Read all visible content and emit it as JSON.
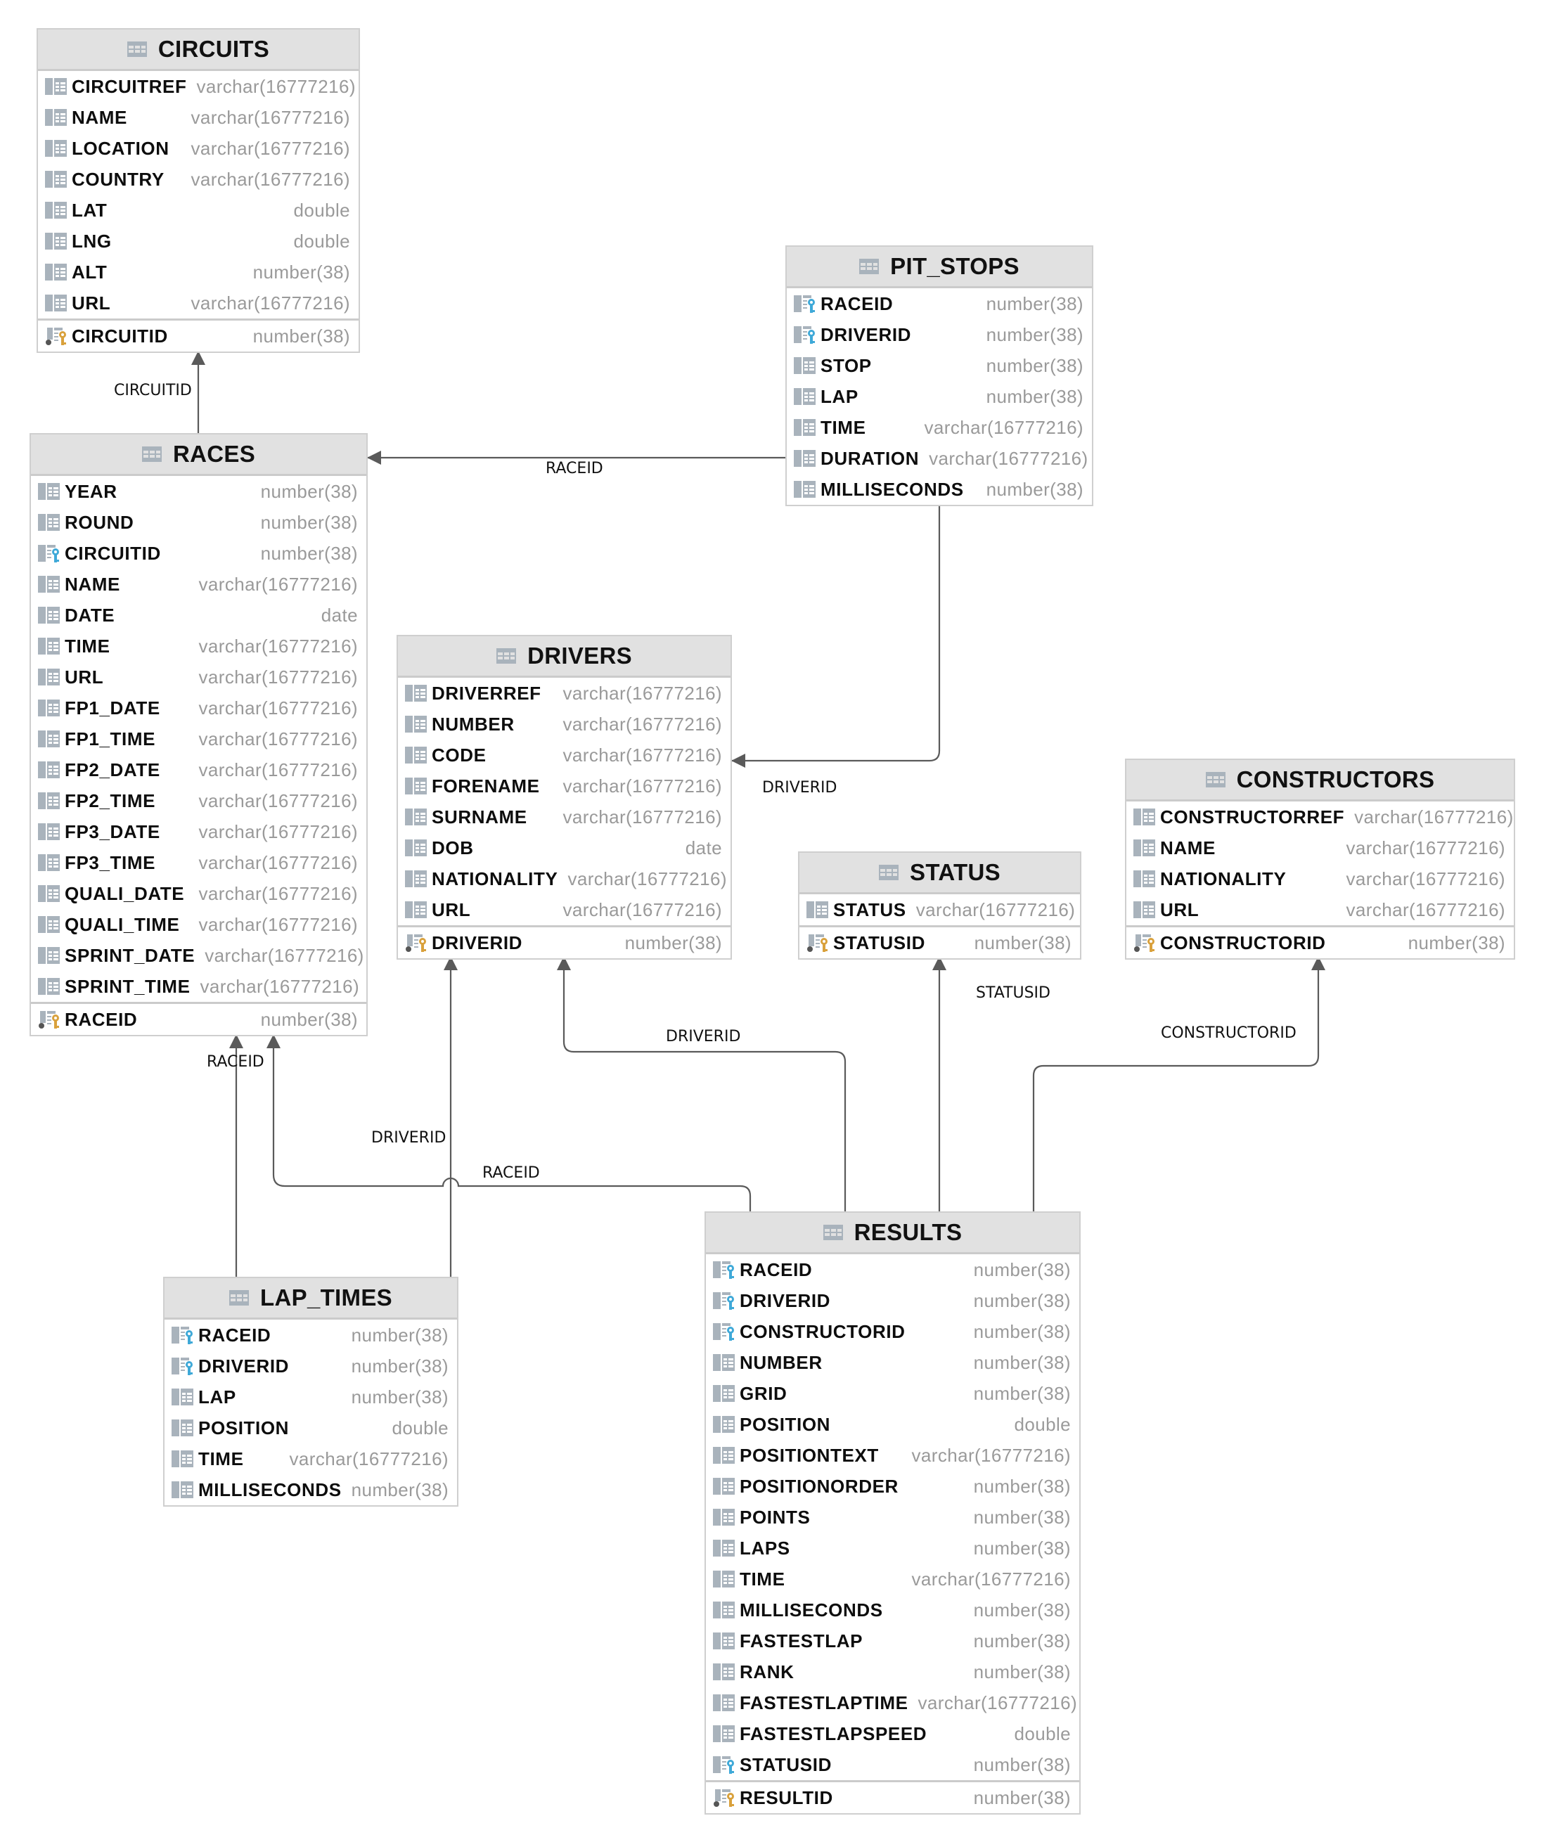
{
  "diagram": {
    "type": "entity-relationship",
    "icons": {
      "table": "table-grid-icon",
      "column": "column-icon",
      "foreign_key": "foreign-key-icon",
      "primary_key": "primary-key-icon"
    },
    "colors": {
      "header_bg": "#e1e1e1",
      "border": "#cfcfcf",
      "type_text": "#9a9a9a",
      "fk_key": "#3fa9d8",
      "pk_key": "#d9a13c",
      "edge": "#5a5a5a"
    }
  },
  "tables": {
    "circuits": {
      "name": "CIRCUITS",
      "columns": [
        {
          "name": "CIRCUITREF",
          "type": "varchar(16777216)",
          "kind": "column"
        },
        {
          "name": "NAME",
          "type": "varchar(16777216)",
          "kind": "column"
        },
        {
          "name": "LOCATION",
          "type": "varchar(16777216)",
          "kind": "column"
        },
        {
          "name": "COUNTRY",
          "type": "varchar(16777216)",
          "kind": "column"
        },
        {
          "name": "LAT",
          "type": "double",
          "kind": "column"
        },
        {
          "name": "LNG",
          "type": "double",
          "kind": "column"
        },
        {
          "name": "ALT",
          "type": "number(38)",
          "kind": "column"
        },
        {
          "name": "URL",
          "type": "varchar(16777216)",
          "kind": "column"
        }
      ],
      "pk": {
        "name": "CIRCUITID",
        "type": "number(38)"
      }
    },
    "races": {
      "name": "RACES",
      "columns": [
        {
          "name": "YEAR",
          "type": "number(38)",
          "kind": "column"
        },
        {
          "name": "ROUND",
          "type": "number(38)",
          "kind": "column"
        },
        {
          "name": "CIRCUITID",
          "type": "number(38)",
          "kind": "fk"
        },
        {
          "name": "NAME",
          "type": "varchar(16777216)",
          "kind": "column"
        },
        {
          "name": "DATE",
          "type": "date",
          "kind": "column"
        },
        {
          "name": "TIME",
          "type": "varchar(16777216)",
          "kind": "column"
        },
        {
          "name": "URL",
          "type": "varchar(16777216)",
          "kind": "column"
        },
        {
          "name": "FP1_DATE",
          "type": "varchar(16777216)",
          "kind": "column"
        },
        {
          "name": "FP1_TIME",
          "type": "varchar(16777216)",
          "kind": "column"
        },
        {
          "name": "FP2_DATE",
          "type": "varchar(16777216)",
          "kind": "column"
        },
        {
          "name": "FP2_TIME",
          "type": "varchar(16777216)",
          "kind": "column"
        },
        {
          "name": "FP3_DATE",
          "type": "varchar(16777216)",
          "kind": "column"
        },
        {
          "name": "FP3_TIME",
          "type": "varchar(16777216)",
          "kind": "column"
        },
        {
          "name": "QUALI_DATE",
          "type": "varchar(16777216)",
          "kind": "column"
        },
        {
          "name": "QUALI_TIME",
          "type": "varchar(16777216)",
          "kind": "column"
        },
        {
          "name": "SPRINT_DATE",
          "type": "varchar(16777216)",
          "kind": "column"
        },
        {
          "name": "SPRINT_TIME",
          "type": "varchar(16777216)",
          "kind": "column"
        }
      ],
      "pk": {
        "name": "RACEID",
        "type": "number(38)"
      }
    },
    "pit_stops": {
      "name": "PIT_STOPS",
      "columns": [
        {
          "name": "RACEID",
          "type": "number(38)",
          "kind": "fk"
        },
        {
          "name": "DRIVERID",
          "type": "number(38)",
          "kind": "fk"
        },
        {
          "name": "STOP",
          "type": "number(38)",
          "kind": "column"
        },
        {
          "name": "LAP",
          "type": "number(38)",
          "kind": "column"
        },
        {
          "name": "TIME",
          "type": "varchar(16777216)",
          "kind": "column"
        },
        {
          "name": "DURATION",
          "type": "varchar(16777216)",
          "kind": "column"
        },
        {
          "name": "MILLISECONDS",
          "type": "number(38)",
          "kind": "column"
        }
      ],
      "pk": null
    },
    "drivers": {
      "name": "DRIVERS",
      "columns": [
        {
          "name": "DRIVERREF",
          "type": "varchar(16777216)",
          "kind": "column"
        },
        {
          "name": "NUMBER",
          "type": "varchar(16777216)",
          "kind": "column"
        },
        {
          "name": "CODE",
          "type": "varchar(16777216)",
          "kind": "column"
        },
        {
          "name": "FORENAME",
          "type": "varchar(16777216)",
          "kind": "column"
        },
        {
          "name": "SURNAME",
          "type": "varchar(16777216)",
          "kind": "column"
        },
        {
          "name": "DOB",
          "type": "date",
          "kind": "column"
        },
        {
          "name": "NATIONALITY",
          "type": "varchar(16777216)",
          "kind": "column"
        },
        {
          "name": "URL",
          "type": "varchar(16777216)",
          "kind": "column"
        }
      ],
      "pk": {
        "name": "DRIVERID",
        "type": "number(38)"
      }
    },
    "status": {
      "name": "STATUS",
      "columns": [
        {
          "name": "STATUS",
          "type": "varchar(16777216)",
          "kind": "column"
        }
      ],
      "pk": {
        "name": "STATUSID",
        "type": "number(38)"
      }
    },
    "constructors": {
      "name": "CONSTRUCTORS",
      "columns": [
        {
          "name": "CONSTRUCTORREF",
          "type": "varchar(16777216)",
          "kind": "column"
        },
        {
          "name": "NAME",
          "type": "varchar(16777216)",
          "kind": "column"
        },
        {
          "name": "NATIONALITY",
          "type": "varchar(16777216)",
          "kind": "column"
        },
        {
          "name": "URL",
          "type": "varchar(16777216)",
          "kind": "column"
        }
      ],
      "pk": {
        "name": "CONSTRUCTORID",
        "type": "number(38)"
      }
    },
    "lap_times": {
      "name": "LAP_TIMES",
      "columns": [
        {
          "name": "RACEID",
          "type": "number(38)",
          "kind": "fk"
        },
        {
          "name": "DRIVERID",
          "type": "number(38)",
          "kind": "fk"
        },
        {
          "name": "LAP",
          "type": "number(38)",
          "kind": "column"
        },
        {
          "name": "POSITION",
          "type": "double",
          "kind": "column"
        },
        {
          "name": "TIME",
          "type": "varchar(16777216)",
          "kind": "column"
        },
        {
          "name": "MILLISECONDS",
          "type": "number(38)",
          "kind": "column"
        }
      ],
      "pk": null
    },
    "results": {
      "name": "RESULTS",
      "columns": [
        {
          "name": "RACEID",
          "type": "number(38)",
          "kind": "fk"
        },
        {
          "name": "DRIVERID",
          "type": "number(38)",
          "kind": "fk"
        },
        {
          "name": "CONSTRUCTORID",
          "type": "number(38)",
          "kind": "fk"
        },
        {
          "name": "NUMBER",
          "type": "number(38)",
          "kind": "column"
        },
        {
          "name": "GRID",
          "type": "number(38)",
          "kind": "column"
        },
        {
          "name": "POSITION",
          "type": "double",
          "kind": "column"
        },
        {
          "name": "POSITIONTEXT",
          "type": "varchar(16777216)",
          "kind": "column"
        },
        {
          "name": "POSITIONORDER",
          "type": "number(38)",
          "kind": "column"
        },
        {
          "name": "POINTS",
          "type": "number(38)",
          "kind": "column"
        },
        {
          "name": "LAPS",
          "type": "number(38)",
          "kind": "column"
        },
        {
          "name": "TIME",
          "type": "varchar(16777216)",
          "kind": "column"
        },
        {
          "name": "MILLISECONDS",
          "type": "number(38)",
          "kind": "column"
        },
        {
          "name": "FASTESTLAP",
          "type": "number(38)",
          "kind": "column"
        },
        {
          "name": "RANK",
          "type": "number(38)",
          "kind": "column"
        },
        {
          "name": "FASTESTLAPTIME",
          "type": "varchar(16777216)",
          "kind": "column"
        },
        {
          "name": "FASTESTLAPSPEED",
          "type": "double",
          "kind": "column"
        },
        {
          "name": "STATUSID",
          "type": "number(38)",
          "kind": "fk"
        }
      ],
      "pk": {
        "name": "RESULTID",
        "type": "number(38)"
      }
    }
  },
  "relationships": [
    {
      "id": "races-circuits",
      "from": "RACES",
      "to": "CIRCUITS",
      "label": "CIRCUITID"
    },
    {
      "id": "pitstops-races",
      "from": "PIT_STOPS",
      "to": "RACES",
      "label": "RACEID"
    },
    {
      "id": "pitstops-drivers",
      "from": "PIT_STOPS",
      "to": "DRIVERS",
      "label": "DRIVERID"
    },
    {
      "id": "laptimes-races",
      "from": "LAP_TIMES",
      "to": "RACES",
      "label": "RACEID"
    },
    {
      "id": "laptimes-drivers",
      "from": "LAP_TIMES",
      "to": "DRIVERS",
      "label": "DRIVERID"
    },
    {
      "id": "results-races",
      "from": "RESULTS",
      "to": "RACES",
      "label": "RACEID"
    },
    {
      "id": "results-drivers",
      "from": "RESULTS",
      "to": "DRIVERS",
      "label": "DRIVERID"
    },
    {
      "id": "results-status",
      "from": "RESULTS",
      "to": "STATUS",
      "label": "STATUSID"
    },
    {
      "id": "results-constructors",
      "from": "RESULTS",
      "to": "CONSTRUCTORS",
      "label": "CONSTRUCTORID"
    }
  ]
}
